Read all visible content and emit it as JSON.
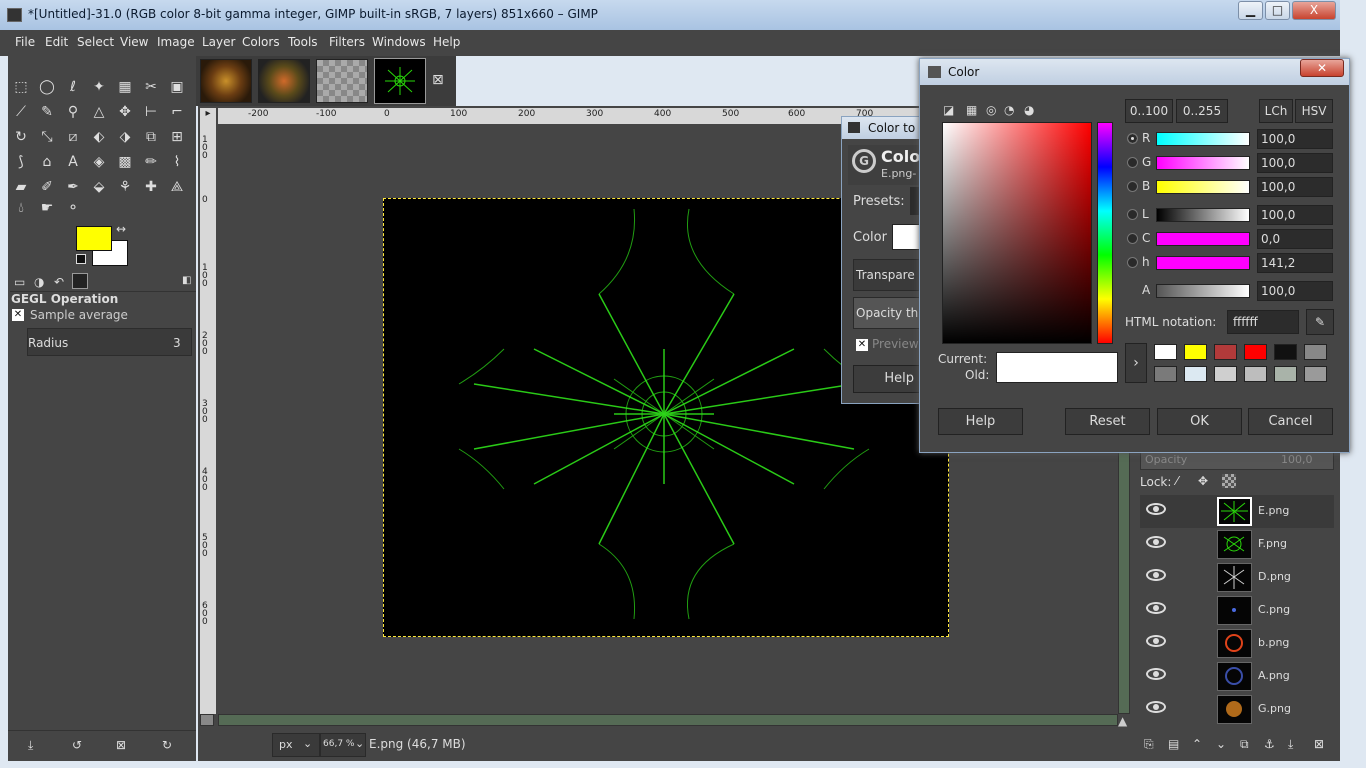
{
  "window": {
    "title": "*[Untitled]-31.0 (RGB color 8-bit gamma integer, GIMP built-in sRGB, 7 layers) 851x660 – GIMP",
    "min": "▭",
    "max": "□",
    "close": "X"
  },
  "menu": [
    "File",
    "Edit",
    "Select",
    "View",
    "Image",
    "Layer",
    "Colors",
    "Tools",
    "Filters",
    "Windows",
    "Help"
  ],
  "tool_options": {
    "heading": "GEGL Operation",
    "checkbox_label": "Sample average",
    "radius_label": "Radius",
    "radius_value": "3"
  },
  "colors": {
    "foreground": "#ffff00",
    "background": "#ffffff",
    "canvas_bg": "#454545",
    "accent": "#29d80a"
  },
  "image_tabs": {
    "close": "⊠"
  },
  "ruler_h": [
    "-200",
    "-100",
    "0",
    "100",
    "200",
    "300",
    "400",
    "500",
    "600",
    "700"
  ],
  "ruler_v": [
    "100",
    "0",
    "100",
    "200",
    "300",
    "400",
    "500",
    "600"
  ],
  "status": {
    "unit": "px",
    "zoom": "66,7 %",
    "info": "E.png (46,7 MB)"
  },
  "layers": {
    "opacity_label": "Opacity",
    "opacity_value": "100,0",
    "lock_label": "Lock:",
    "items": [
      "E.png",
      "F.png",
      "D.png",
      "C.png",
      "b.png",
      "A.png",
      "G.png"
    ]
  },
  "color_to_alpha": {
    "title": "Color to A",
    "heading": "Colo",
    "sub": "E.png-",
    "presets": "Presets:",
    "color": "Color",
    "transparency": "Transpare",
    "opacity": "Opacity th",
    "preview": "Preview",
    "help": "Help"
  },
  "color_dialog": {
    "title": "Color",
    "range_buttons": [
      "0..100",
      "0..255"
    ],
    "mode_buttons": [
      "LCh",
      "HSV"
    ],
    "channels": [
      {
        "label": "R",
        "value": "100,0"
      },
      {
        "label": "G",
        "value": "100,0"
      },
      {
        "label": "B",
        "value": "100,0"
      },
      {
        "label": "L",
        "value": "100,0"
      },
      {
        "label": "C",
        "value": "0,0"
      },
      {
        "label": "h",
        "value": "141,2"
      },
      {
        "label": "A",
        "value": "100,0"
      }
    ],
    "html_label": "HTML notation:",
    "html_value": "ffffff",
    "current_label": "Current:",
    "old_label": "Old:",
    "history": [
      "#ffffff",
      "#ffff00",
      "#b23a3a",
      "#ff0000",
      "#111111",
      "#888888",
      "#7a7a7a",
      "#dce9f2",
      "#cfcfcf",
      "#bdbdbd",
      "#a9b3a9",
      "#9a9a9a"
    ],
    "buttons": {
      "help": "Help",
      "reset": "Reset",
      "ok": "OK",
      "cancel": "Cancel"
    }
  }
}
